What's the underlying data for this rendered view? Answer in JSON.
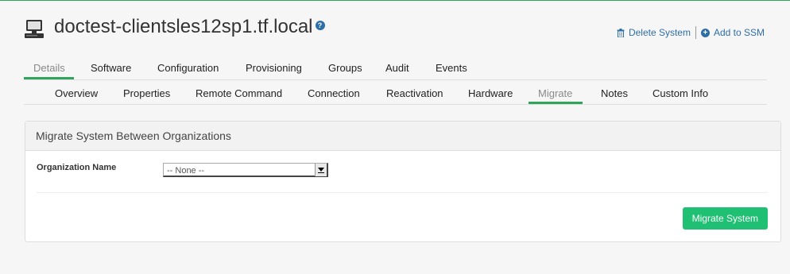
{
  "header": {
    "title": "doctest-clientsles12sp1.tf.local",
    "help_icon": "question-circle-icon",
    "system_icon": "desktop-computer-icon",
    "actions": {
      "delete_label": "Delete System",
      "add_ssm_label": "Add to SSM"
    }
  },
  "tabs_primary": {
    "items": [
      "Details",
      "Software",
      "Configuration",
      "Provisioning",
      "Groups",
      "Audit",
      "Events"
    ],
    "active": "Details"
  },
  "tabs_secondary": {
    "items": [
      "Overview",
      "Properties",
      "Remote Command",
      "Connection",
      "Reactivation",
      "Hardware",
      "Migrate",
      "Notes",
      "Custom Info"
    ],
    "active": "Migrate"
  },
  "panel": {
    "title": "Migrate System Between Organizations",
    "org_label": "Organization Name",
    "org_selected": "-- None --",
    "submit_label": "Migrate System"
  },
  "colors": {
    "accent_green": "#2ea55b",
    "button_green": "#1fbf74",
    "link_blue": "#2e6ea7"
  }
}
